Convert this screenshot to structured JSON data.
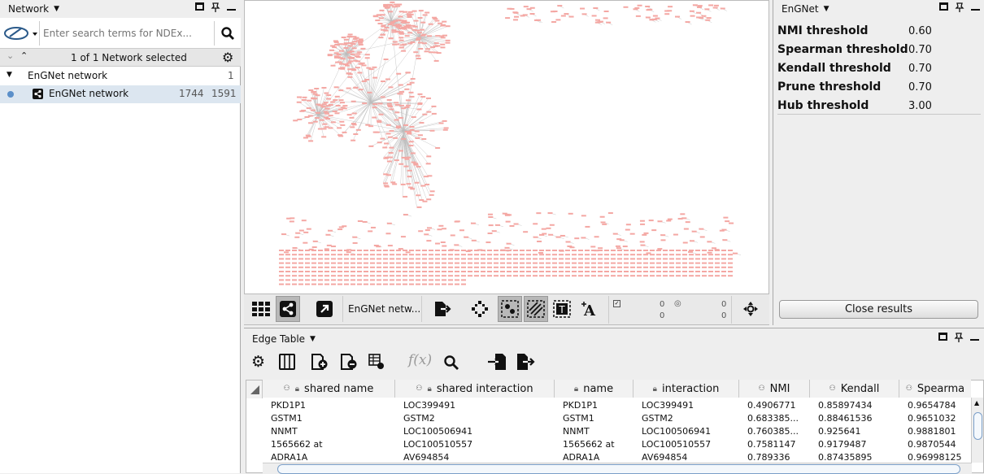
{
  "network_panel": {
    "title": "Network",
    "search_placeholder": "Enter search terms for NDEx...",
    "selection_status": "1 of 1 Network selected",
    "collection": {
      "name": "EnGNet network",
      "count": "1"
    },
    "network": {
      "name": "EnGNet network",
      "nodes": "1744",
      "edges": "1591"
    }
  },
  "engnet_panel": {
    "title": "EnGNet",
    "thresholds": [
      {
        "label": "NMI threshold",
        "value": "0.60"
      },
      {
        "label": "Spearman threshold",
        "value": "0.70"
      },
      {
        "label": "Kendall threshold",
        "value": "0.70"
      },
      {
        "label": "Prune threshold",
        "value": "0.70"
      },
      {
        "label": "Hub threshold",
        "value": "3.00"
      }
    ],
    "close_button": "Close results"
  },
  "view_toolbar": {
    "network_name": "EnGNet netw...",
    "selected_nodes": "0",
    "total_nodes": "0",
    "hidden_nodes": "0",
    "hidden_total": "0"
  },
  "edge_table": {
    "title": "Edge Table",
    "fx_label": "f(x)",
    "columns": [
      "shared name",
      "shared interaction",
      "name",
      "interaction",
      "NMI",
      "Kendall",
      "Spearma"
    ],
    "rows": [
      [
        "PKD1P1",
        "LOC399491",
        "PKD1P1",
        "LOC399491",
        "0.4906771",
        "0.85897434",
        "0.9654784"
      ],
      [
        "GSTM1",
        "GSTM2",
        "GSTM1",
        "GSTM2",
        "0.683385...",
        "0.88461536",
        "0.9651032"
      ],
      [
        "NNMT",
        "LOC100506941",
        "NNMT",
        "LOC100506941",
        "0.760385...",
        "0.925641",
        "0.9881801"
      ],
      [
        "1565662 at",
        "LOC100510557",
        "1565662 at",
        "LOC100510557",
        "0.7581147",
        "0.9179487",
        "0.9870544"
      ],
      [
        "ADRA1A",
        "AV694854",
        "ADRA1A",
        "AV694854",
        "0.789336",
        "0.87435895",
        "0.96998125"
      ]
    ]
  },
  "colors": {
    "node": "#f4a7a3",
    "edge": "#bdbdbd",
    "selected_row": "#dce6f0"
  }
}
